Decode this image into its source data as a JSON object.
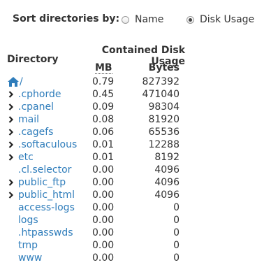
{
  "sort": {
    "label": "Sort directories by:",
    "options": [
      {
        "label": "Name",
        "checked": false
      },
      {
        "label": "Disk Usage",
        "checked": true
      }
    ]
  },
  "table": {
    "group_header": "Contained Disk Usage",
    "dir_header": "Directory",
    "mb_header": "MB",
    "bytes_header": "Bytes",
    "rows": [
      {
        "name": "/",
        "mb": "0.79",
        "bytes": "827392",
        "icon": "home-icon",
        "expandable": false
      },
      {
        "name": ".cphorde",
        "mb": "0.45",
        "bytes": "471040",
        "expandable": true
      },
      {
        "name": ".cpanel",
        "mb": "0.09",
        "bytes": "98304",
        "expandable": true
      },
      {
        "name": "mail",
        "mb": "0.08",
        "bytes": "81920",
        "expandable": true
      },
      {
        "name": ".cagefs",
        "mb": "0.06",
        "bytes": "65536",
        "expandable": true
      },
      {
        "name": ".softaculous",
        "mb": "0.01",
        "bytes": "12288",
        "expandable": true
      },
      {
        "name": "etc",
        "mb": "0.01",
        "bytes": "8192",
        "expandable": true
      },
      {
        "name": ".cl.selector",
        "mb": "0.00",
        "bytes": "4096",
        "expandable": false
      },
      {
        "name": "public_ftp",
        "mb": "0.00",
        "bytes": "4096",
        "expandable": true
      },
      {
        "name": "public_html",
        "mb": "0.00",
        "bytes": "4096",
        "expandable": true
      },
      {
        "name": "access-logs",
        "mb": "0.00",
        "bytes": "0",
        "expandable": false
      },
      {
        "name": "logs",
        "mb": "0.00",
        "bytes": "0",
        "expandable": false
      },
      {
        "name": ".htpasswds",
        "mb": "0.00",
        "bytes": "0",
        "expandable": false
      },
      {
        "name": "tmp",
        "mb": "0.00",
        "bytes": "0",
        "expandable": false
      },
      {
        "name": "www",
        "mb": "0.00",
        "bytes": "0",
        "expandable": false
      }
    ]
  },
  "colors": {
    "link": "#2f7dbb",
    "text": "#333333"
  }
}
